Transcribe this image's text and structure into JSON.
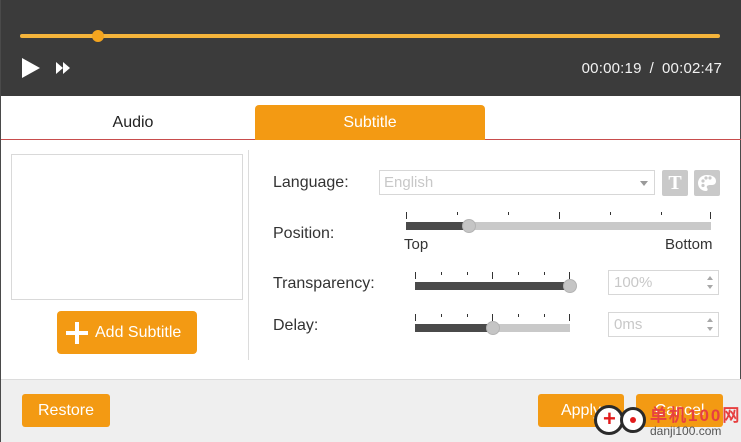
{
  "player": {
    "progress_fraction": 0.111,
    "current_time": "00:00:19",
    "separator": "/",
    "total_time": "00:02:47"
  },
  "tabs": [
    {
      "label": "Audio",
      "active": false
    },
    {
      "label": "Subtitle",
      "active": true
    }
  ],
  "left_pane": {
    "add_subtitle_label": "Add Subtitle"
  },
  "settings": {
    "language_label": "Language:",
    "language_value": "English",
    "position_label": "Position:",
    "position_value_fraction": 0.205,
    "position_min_label": "Top",
    "position_max_label": "Bottom",
    "transparency_label": "Transparency:",
    "transparency_value_fraction": 1.0,
    "transparency_value": "100%",
    "delay_label": "Delay:",
    "delay_value_fraction": 0.5,
    "delay_value": "0ms"
  },
  "footer": {
    "restore_label": "Restore",
    "apply_label": "Apply",
    "cancel_label": "Cancel"
  },
  "watermark": {
    "text_cn": "单机100网",
    "text_url": "danji100.com"
  },
  "colors": {
    "accent": "#f39a13",
    "player_bg": "#3b3b3b",
    "seek": "#f4b43b"
  }
}
